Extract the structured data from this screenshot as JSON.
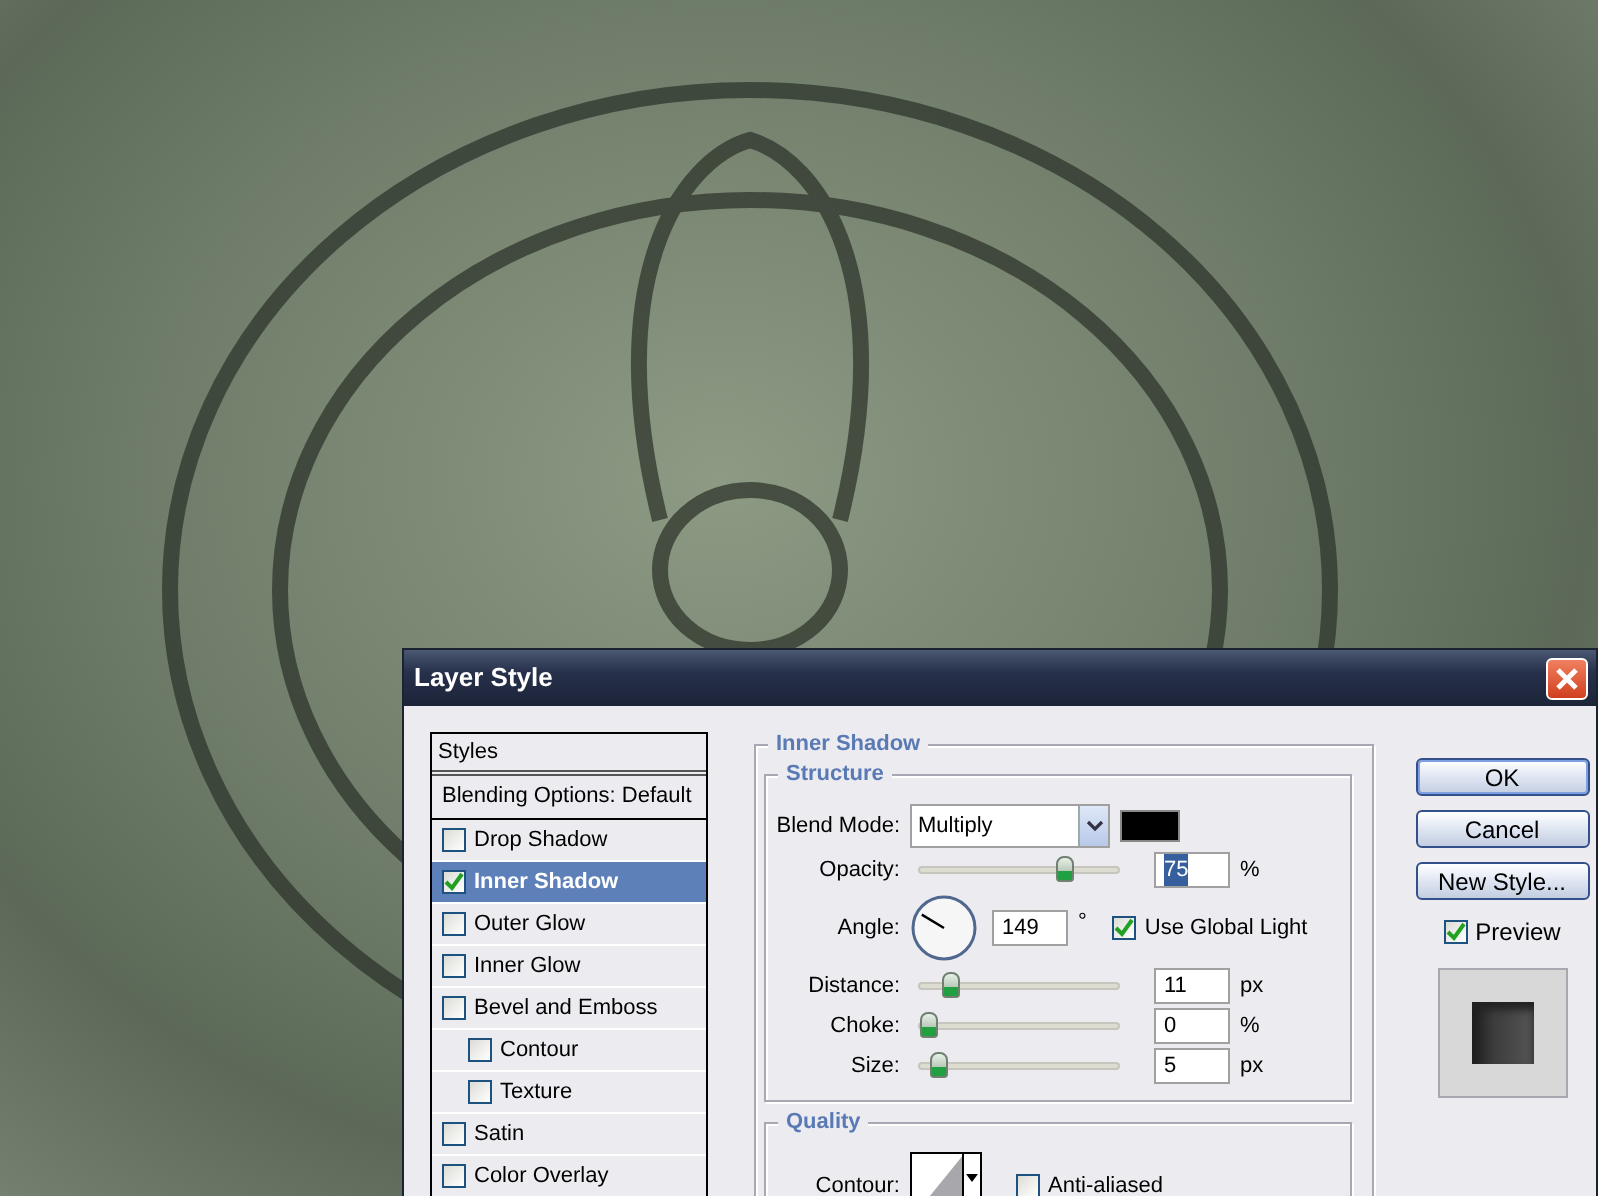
{
  "window": {
    "title": "Layer Style"
  },
  "styles_list": {
    "header": "Styles",
    "items": [
      {
        "label": "Blending Options: Default",
        "kind": "plain",
        "selected": false
      },
      {
        "label": "Drop Shadow",
        "kind": "check",
        "checked": false,
        "selected": false
      },
      {
        "label": "Inner Shadow",
        "kind": "check",
        "checked": true,
        "selected": true
      },
      {
        "label": "Outer Glow",
        "kind": "check",
        "checked": false,
        "selected": false
      },
      {
        "label": "Inner Glow",
        "kind": "check",
        "checked": false,
        "selected": false
      },
      {
        "label": "Bevel and Emboss",
        "kind": "check",
        "checked": false,
        "selected": false,
        "children": [
          {
            "label": "Contour",
            "kind": "check",
            "checked": false,
            "selected": false
          },
          {
            "label": "Texture",
            "kind": "check",
            "checked": false,
            "selected": false
          }
        ]
      },
      {
        "label": "Satin",
        "kind": "check",
        "checked": false,
        "selected": false
      },
      {
        "label": "Color Overlay",
        "kind": "check",
        "checked": false,
        "selected": false
      }
    ]
  },
  "panel": {
    "title": "Inner Shadow",
    "structure": {
      "title": "Structure",
      "blend_mode": {
        "label": "Blend Mode:",
        "value": "Multiply"
      },
      "rows": [
        {
          "kind": "slider",
          "label": "Opacity:",
          "level": 0.75,
          "value": "75",
          "unit": "%",
          "highlighted": true
        },
        {
          "kind": "angle",
          "label": "Angle:",
          "value": "149",
          "unit": "°",
          "global_light": {
            "label": "Use Global Light",
            "checked": true
          }
        },
        {
          "kind": "slider",
          "label": "Distance:",
          "level": 0.12,
          "value": "11",
          "unit": "px",
          "highlighted": false
        },
        {
          "kind": "slider",
          "label": "Choke:",
          "level": 0,
          "value": "0",
          "unit": "%",
          "highlighted": false
        },
        {
          "kind": "slider",
          "label": "Size:",
          "level": 0.05,
          "value": "5",
          "unit": "px",
          "highlighted": false
        }
      ]
    },
    "quality": {
      "title": "Quality",
      "contour": {
        "label": "Contour:"
      },
      "anti_aliased": {
        "label": "Anti-aliased",
        "checked": false
      }
    }
  },
  "buttons": [
    {
      "label": "OK",
      "default": true
    },
    {
      "label": "Cancel",
      "default": false
    },
    {
      "label": "New Style...",
      "default": false
    }
  ],
  "preview": {
    "label": "Preview",
    "checked": true
  }
}
